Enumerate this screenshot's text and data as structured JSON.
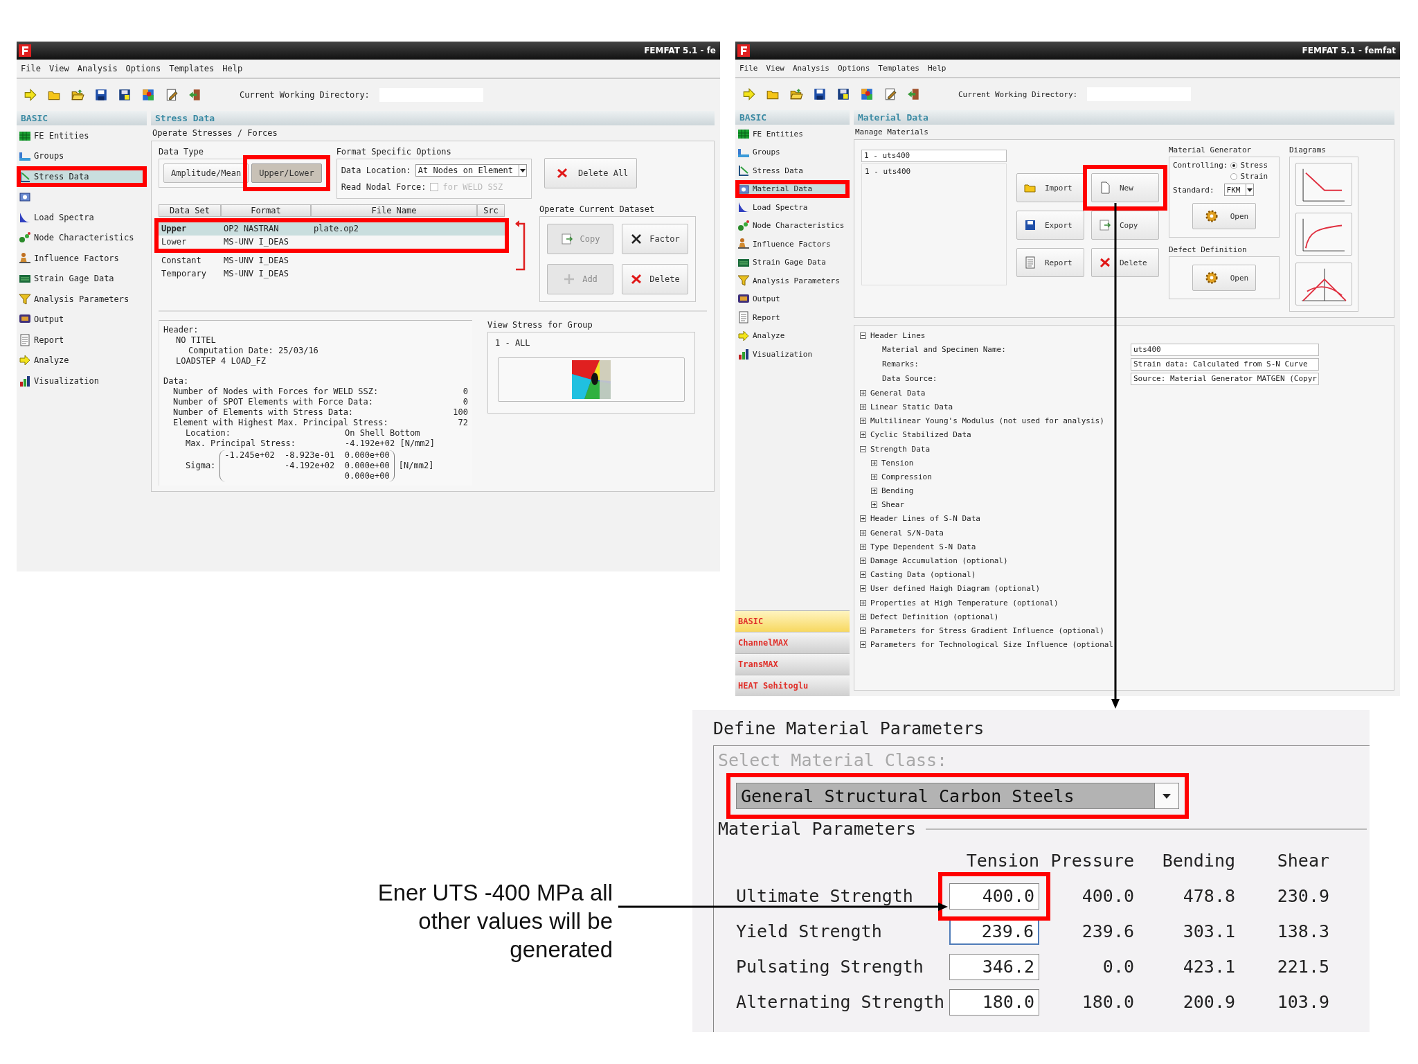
{
  "stress_window": {
    "title": "FEMFAT 5.1 - fe",
    "menu": [
      "File",
      "View",
      "Analysis",
      "Options",
      "Templates",
      "Help"
    ],
    "toolbar": [
      {
        "kind": "go"
      },
      {
        "kind": "new"
      },
      {
        "kind": "open"
      },
      {
        "kind": "save"
      },
      {
        "kind": "save_as"
      },
      {
        "kind": "palette"
      },
      {
        "kind": "edit"
      },
      {
        "kind": "exit"
      }
    ],
    "cwd_label": "Current Working Directory:",
    "sidebar": {
      "header": "BASIC",
      "items": [
        {
          "label": "FE Entities",
          "kind": "fe",
          "selected": false
        },
        {
          "label": "Groups",
          "kind": "groups",
          "selected": false
        },
        {
          "label": "Stress Data",
          "kind": "stress",
          "selected": true
        },
        {
          "kind": "material",
          "selected": false
        },
        {
          "label": "Load Spectra",
          "kind": "spectra",
          "selected": false
        },
        {
          "label": "Node Characteristics",
          "kind": "node",
          "selected": false
        },
        {
          "label": "Influence Factors",
          "kind": "influence",
          "selected": false
        },
        {
          "label": "Strain Gage Data",
          "kind": "gage",
          "selected": false
        },
        {
          "label": "Analysis Parameters",
          "kind": "params",
          "selected": false
        },
        {
          "label": "Output",
          "kind": "output",
          "selected": false
        },
        {
          "label": "Report",
          "kind": "report",
          "selected": false
        },
        {
          "label": "Analyze",
          "kind": "go",
          "selected": false
        },
        {
          "label": "Visualization",
          "kind": "visual",
          "selected": false
        }
      ]
    },
    "section_title": "Stress Data",
    "subtitle": "Operate Stresses / Forces",
    "data_type": {
      "label": "Data Type",
      "options": [
        {
          "label": "Amplitude/Mean",
          "selected": false
        },
        {
          "label": "Upper/Lower",
          "selected": true
        }
      ]
    },
    "format_options": {
      "label": "Format Specific Options",
      "location_label": "Data Location:",
      "location_value": "At Nodes on Element",
      "nodal_force_label": "Read Nodal Force:",
      "nodal_force_option": "for WELD SSZ",
      "nodal_force_checked": false,
      "nodal_force_disabled": true
    },
    "delete_all": "Delete All",
    "table": {
      "columns": [
        "Data Set",
        "Format",
        "File Name",
        "Src"
      ],
      "rows": [
        {
          "cells": [
            "Upper",
            "OP2 NASTRAN",
            "plate.op2"
          ],
          "selected": true
        },
        {
          "cells": [
            "Lower",
            "MS-UNV I_DEAS"
          ],
          "selected": false
        },
        {
          "cells": [
            "Constant",
            "MS-UNV I_DEAS"
          ],
          "selected": false
        },
        {
          "cells": [
            "Temporary",
            "MS-UNV I_DEAS"
          ],
          "selected": false
        }
      ]
    },
    "dataset_ops": {
      "label": "Operate Current Dataset",
      "buttons": [
        {
          "label": "Copy",
          "kind": "copy",
          "disabled": true
        },
        {
          "label": "Factor",
          "kind": "factor",
          "disabled": false
        },
        {
          "label": "Add",
          "kind": "add",
          "disabled": true
        },
        {
          "label": "Delete",
          "kind": "delete",
          "disabled": false
        }
      ]
    },
    "info": {
      "header_label": "Header:",
      "header_lines": [
        "NO TITEL",
        "Computation Date: 25/03/16",
        "LOADSTEP 4 LOAD_FZ"
      ],
      "data_label": "Data:",
      "rows": [
        {
          "label": "Number of Nodes with Forces for WELD SSZ:",
          "value": "0"
        },
        {
          "label": "Number of SPOT Elements with Force Data:",
          "value": "0"
        },
        {
          "label": "Number of Elements with Stress Data:",
          "value": "100"
        },
        {
          "label": "Element with Highest Max. Principal Stress:",
          "value": "72"
        }
      ],
      "details": [
        {
          "label": "Location:",
          "value": "On Shell Bottom"
        },
        {
          "label": "Max. Principal Stress:",
          "value": "-4.192e+02 [N/mm2]"
        }
      ],
      "sigma_label": "Sigma:",
      "sigma_rows": [
        "-1.245e+02  -8.923e-01  0.000e+00",
        "-4.192e+02  0.000e+00",
        "0.000e+00"
      ],
      "sigma_unit": "[N/mm2]"
    },
    "group_view": {
      "label": "View Stress for Group",
      "items": [
        "1 - ALL"
      ]
    }
  },
  "material_window": {
    "title": "FEMFAT 5.1 - femfat",
    "menu": [
      "File",
      "View",
      "Analysis",
      "Options",
      "Templates",
      "Help"
    ],
    "toolbar": [
      {
        "kind": "go"
      },
      {
        "kind": "new"
      },
      {
        "kind": "open"
      },
      {
        "kind": "save"
      },
      {
        "kind": "save_as"
      },
      {
        "kind": "palette"
      },
      {
        "kind": "edit"
      },
      {
        "kind": "exit"
      }
    ],
    "cwd_label": "Current Working Directory:",
    "sidebar": {
      "header": "BASIC",
      "items": [
        {
          "label": "FE Entities",
          "kind": "fe",
          "selected": false
        },
        {
          "label": "Groups",
          "kind": "groups",
          "selected": false
        },
        {
          "label": "Stress Data",
          "kind": "stress",
          "selected": false
        },
        {
          "label": "Material Data",
          "kind": "material",
          "selected": true
        },
        {
          "label": "Load Spectra",
          "kind": "spectra",
          "selected": false
        },
        {
          "label": "Node Characteristics",
          "kind": "node",
          "selected": false
        },
        {
          "label": "Influence Factors",
          "kind": "influence",
          "selected": false
        },
        {
          "label": "Strain Gage Data",
          "kind": "gage",
          "selected": false
        },
        {
          "label": "Analysis Parameters",
          "kind": "params",
          "selected": false
        },
        {
          "label": "Output",
          "kind": "output",
          "selected": false
        },
        {
          "label": "Report",
          "kind": "report",
          "selected": false
        },
        {
          "label": "Analyze",
          "kind": "go",
          "selected": false
        },
        {
          "label": "Visualization",
          "kind": "visual",
          "selected": false
        }
      ]
    },
    "modules": [
      {
        "label": "BASIC",
        "selected": true
      },
      {
        "label": "ChannelMAX",
        "selected": false
      },
      {
        "label": "TransMAX",
        "selected": false
      },
      {
        "label": "HEAT Sehitoglu",
        "selected": false
      }
    ],
    "section_title": "Material Data",
    "subtitle": "Manage Materials",
    "material_field": "1 - uts400",
    "materials": [
      {
        "label": "1 - uts400",
        "selected": false
      }
    ],
    "buttons": [
      {
        "label": "Import",
        "kind": "import"
      },
      {
        "label": "New",
        "kind": "new_page"
      },
      {
        "label": "Export",
        "kind": "export"
      },
      {
        "label": "Copy",
        "kind": "copy"
      },
      {
        "label": "Report",
        "kind": "report"
      },
      {
        "label": "Delete",
        "kind": "delete"
      }
    ],
    "generator": {
      "label": "Material Generator",
      "controlling_label": "Controlling:",
      "modes": [
        {
          "label": "Stress",
          "selected": true
        },
        {
          "label": "Strain",
          "selected": false
        }
      ],
      "standard_label": "Standard:",
      "standard_value": "FKM",
      "open": "Open"
    },
    "defect": {
      "label": "Defect Definition",
      "open": "Open"
    },
    "diagrams": {
      "label": "Diagrams",
      "items": [
        {
          "kind": "sn"
        },
        {
          "kind": "curve"
        },
        {
          "kind": "haigh"
        }
      ]
    },
    "tree": [
      {
        "label": "Header Lines",
        "expanded": true,
        "children": [
          {
            "label": "Material and Specimen Name:",
            "value": "uts400"
          },
          {
            "label": "Remarks:",
            "value": "Strain data: Calculated from S-N Curve"
          },
          {
            "label": "Data Source:",
            "value": "Source: Material Generator MATGEN (Copyr"
          }
        ]
      },
      {
        "label": "General Data",
        "expanded": false
      },
      {
        "label": "Linear Static Data",
        "expanded": false
      },
      {
        "label": "Multilinear Young's Modulus (not used for analysis)",
        "expanded": false
      },
      {
        "label": "Cyclic Stabilized Data",
        "expanded": false
      },
      {
        "label": "Strength Data",
        "expanded": true,
        "children": [
          {
            "label": "Tension",
            "expanded": false
          },
          {
            "label": "Compression",
            "expanded": false
          },
          {
            "label": "Bending",
            "expanded": false
          },
          {
            "label": "Shear",
            "expanded": false
          }
        ]
      },
      {
        "label": "Header Lines of S-N Data",
        "expanded": false
      },
      {
        "label": "General S/N-Data",
        "expanded": false
      },
      {
        "label": "Type Dependent S-N Data",
        "expanded": false
      },
      {
        "label": "Damage Accumulation (optional)",
        "expanded": false
      },
      {
        "label": "Casting Data (optional)",
        "expanded": false
      },
      {
        "label": "User defined Haigh Diagram (optional)",
        "expanded": false
      },
      {
        "label": "Properties at High Temperature (optional)",
        "expanded": false
      },
      {
        "label": "Defect Definition (optional)",
        "expanded": false
      },
      {
        "label": "Parameters for Stress Gradient Influence (optional)",
        "expanded": false
      },
      {
        "label": "Parameters for Technological Size Influence (optional",
        "expanded": false
      }
    ]
  },
  "dialog": {
    "title": "Define Material Parameters",
    "class_label": "Select Material Class:",
    "class_value": "General Structural Carbon Steels",
    "params_label": "Material Parameters",
    "columns": [
      "Tension",
      "Pressure",
      "Bending",
      "Shear"
    ],
    "rows": [
      {
        "label": "Ultimate Strength",
        "tension": "400.0",
        "focused": false,
        "values": [
          "400.0",
          "478.8",
          "230.9"
        ]
      },
      {
        "label": "Yield Strength",
        "tension": "239.6",
        "focused": true,
        "values": [
          "239.6",
          "303.1",
          "138.3"
        ]
      },
      {
        "label": "Pulsating Strength",
        "tension": "346.2",
        "focused": false,
        "values": [
          "0.0",
          "423.1",
          "221.5"
        ]
      },
      {
        "label": "Alternating Strength",
        "tension": "180.0",
        "focused": false,
        "values": [
          "180.0",
          "200.9",
          "103.9"
        ]
      }
    ]
  },
  "annotation": "Ener UTS -400 MPa all other values will be generated"
}
